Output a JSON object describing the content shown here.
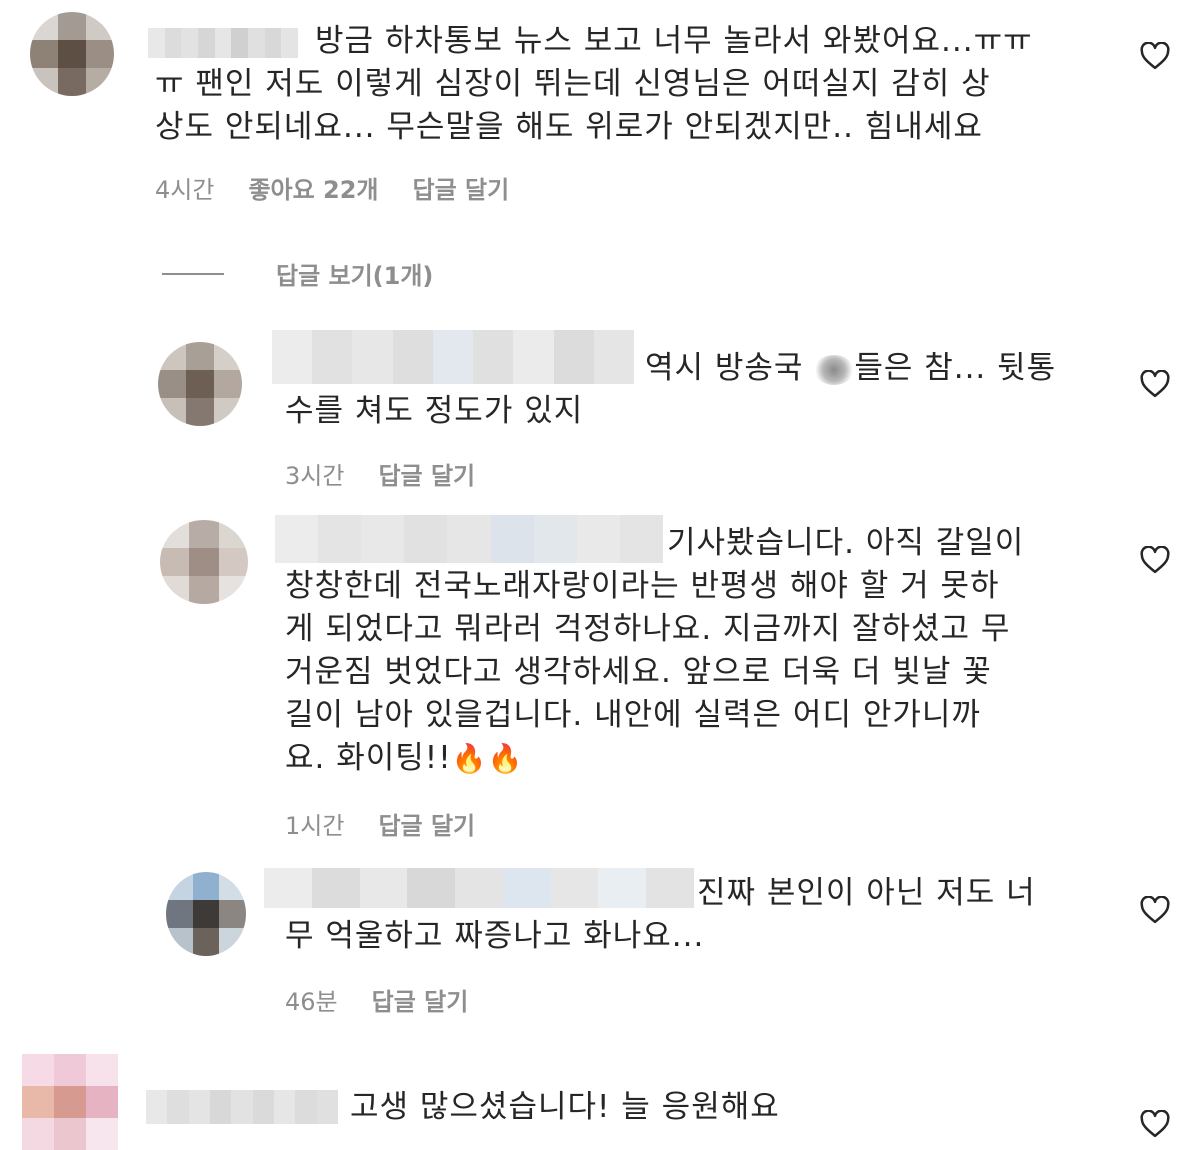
{
  "comments": [
    {
      "text": "방금 하차통보 뉴스 보고 너무 놀라서 와봤어요...ㅠㅠ\nㅠ 팬인 저도 이렇게 심장이 뛰는데 신영님은 어떠실지 감히 상\n상도 안되네요... 무슨말을 해도 위로가 안되겠지만.. 힘내세요",
      "time": "4시간",
      "likes": "좋아요 22개",
      "reply": "답글 달기",
      "view_replies": "답글 보기(1개)",
      "avatar_colors": [
        "#d9d6d3",
        "#a39b93",
        "#cfcac4",
        "#8e8176",
        "#5e4f44",
        "#9b8f85",
        "#c9c3bd",
        "#786a60",
        "#b5aca4"
      ],
      "username_colors": [
        "#e8e8e8",
        "#dcdcdc",
        "#e2e2e2",
        "#d6d6d6",
        "#e6e6e6",
        "#d0d0d0",
        "#e0e0e0",
        "#d8d8d8",
        "#e4e4e4"
      ]
    },
    {
      "text_before": "역시 방송국 ",
      "text_after": "들은 참... 뒷통\n수를 쳐도 정도가 있지",
      "time": "3시간",
      "reply": "답글 달기",
      "avatar_colors": [
        "#cdc6bf",
        "#a89f96",
        "#d5cfc9",
        "#9a8f86",
        "#6e5f54",
        "#b3a89f",
        "#c7c0b9",
        "#857870",
        "#d0cac4"
      ],
      "username_colors": [
        "#ececec",
        "#e1e1e1",
        "#e7e7e7",
        "#dedede",
        "#e3e8ee",
        "#e0e0e0",
        "#ebebeb",
        "#dcdcdc",
        "#e5e5e5"
      ]
    },
    {
      "text": "기사봤습니다. 아직 갈일이\n창창한데 전국노래자랑이라는 반평생 해야 할 거 못하\n게 되었다고 뭐라러 걱정하나요. 지금까지 잘하셨고 무\n거운짐 벗었다고 생각하세요. 앞으로 더욱 더 빛날 꽃\n길이 남아 있을겁니다. 내안에 실력은 어디 안가니까\n요. 화이팅!!",
      "emoji": "🔥🔥",
      "time": "1시간",
      "reply": "답글 달기",
      "avatar_colors": [
        "#e2dedb",
        "#b7aca6",
        "#dcd6d1",
        "#c8bbb3",
        "#9e8e85",
        "#d3c9c2",
        "#e0dbd7",
        "#b5a9a2",
        "#e6e2df"
      ],
      "username_colors": [
        "#ececec",
        "#e4e4e4",
        "#e8e8e8",
        "#e1e1e1",
        "#e6e6e6",
        "#dde3ea",
        "#e2e7ec",
        "#e9e9e9",
        "#e4e4e4"
      ]
    },
    {
      "text": "진짜 본인이 아닌 저도 너\n무 억울하고 짜증나고 화나요...",
      "time": "46분",
      "reply": "답글 달기",
      "avatar_colors": [
        "#c4d4e2",
        "#8fb1cf",
        "#d2dde6",
        "#6f7680",
        "#3e3a38",
        "#8c8682",
        "#b8c2ca",
        "#6b625c",
        "#cdd5dc"
      ],
      "username_colors": [
        "#ececec",
        "#dcdcdc",
        "#e8e8e8",
        "#d8d8d8",
        "#e4e4e4",
        "#dde5ee",
        "#e6e6e6",
        "#e9eef3",
        "#e3e3e3"
      ]
    },
    {
      "text": "고생 많으셨습니다! 늘 응원해요",
      "avatar_colors": [
        "#f6dbe6",
        "#f0c9d8",
        "#f7e1ea",
        "#e8b8a9",
        "#d79a91",
        "#e5b3c2",
        "#f4d8e2",
        "#ecc6cf",
        "#f8e6ee"
      ],
      "username_colors": [
        "#e8e8e8",
        "#dedede",
        "#e4e4e4",
        "#d8d8d8",
        "#e2e2e2",
        "#dadada",
        "#e6e6e6",
        "#dcdcdc",
        "#e0e0e0"
      ]
    }
  ],
  "colors": {
    "text": "#262626",
    "secondary": "#8e8e8e",
    "heart_stroke": "#262626"
  }
}
